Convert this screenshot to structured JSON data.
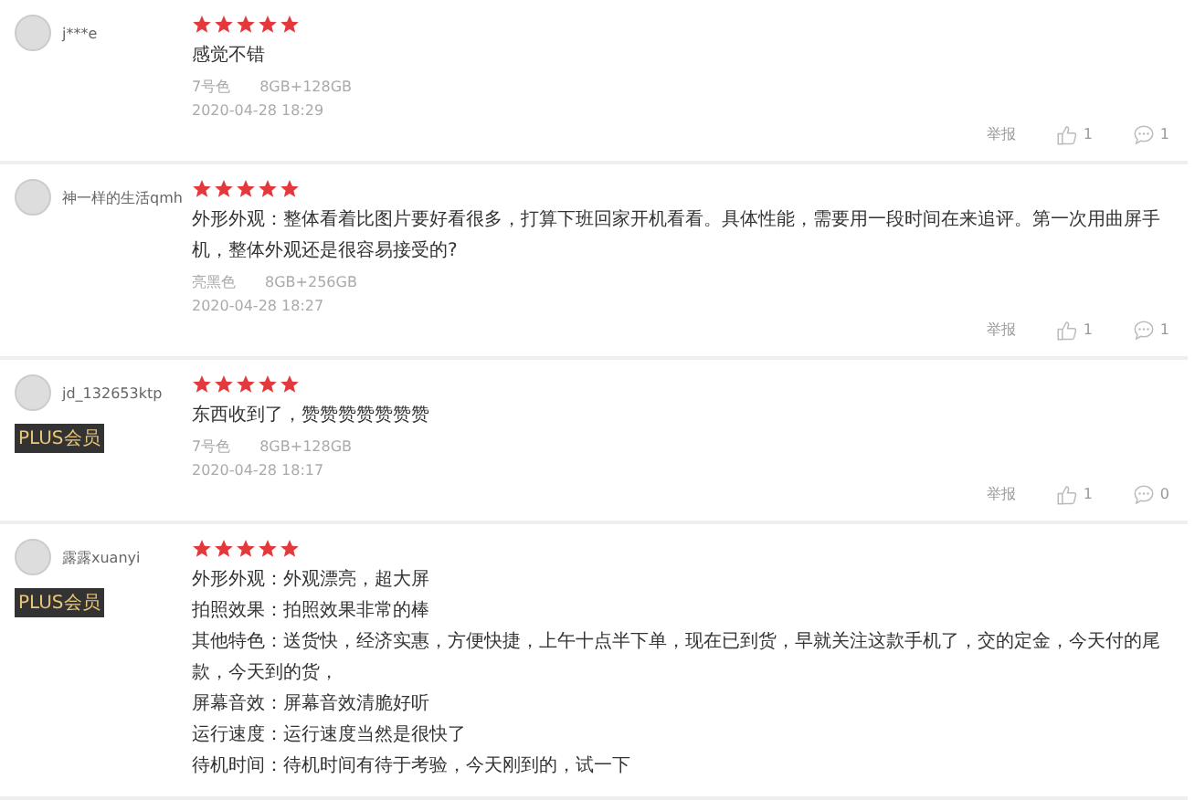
{
  "reviews": [
    {
      "user": "j***e",
      "stars": 5,
      "lines": [
        "感觉不错"
      ],
      "variant": "7号色",
      "spec": "8GB+128GB",
      "time": "2020-04-28 18:29",
      "report": "举报",
      "likes": "1",
      "replies": "1"
    },
    {
      "user": "神一样的生活qmh",
      "stars": 5,
      "lines": [
        "外形外观：整体看着比图片要好看很多，打算下班回家开机看看。具体性能，需要用一段时间在来追评。第一次用曲屏手机，整体外观还是很容易接受的?"
      ],
      "variant": "亮黑色",
      "spec": "8GB+256GB",
      "time": "2020-04-28 18:27",
      "report": "举报",
      "likes": "1",
      "replies": "1"
    },
    {
      "user": "jd_132653ktp",
      "plus_badge": "PLUS会员",
      "stars": 5,
      "lines": [
        "东西收到了，赞赞赞赞赞赞赞"
      ],
      "variant": "7号色",
      "spec": "8GB+128GB",
      "time": "2020-04-28 18:17",
      "report": "举报",
      "likes": "1",
      "replies": "0"
    },
    {
      "user": "露露xuanyi",
      "plus_badge": "PLUS会员",
      "stars": 5,
      "lines": [
        "外形外观：外观漂亮，超大屏",
        "拍照效果：拍照效果非常的棒",
        "其他特色：送货快，经济实惠，方便快捷，上午十点半下单，现在已到货，早就关注这款手机了，交的定金，今天付的尾款，今天到的货，",
        "屏幕音效：屏幕音效清脆好听",
        "运行速度：运行速度当然是很快了",
        "待机时间：待机时间有待于考验，今天刚到的，试一下"
      ]
    }
  ]
}
